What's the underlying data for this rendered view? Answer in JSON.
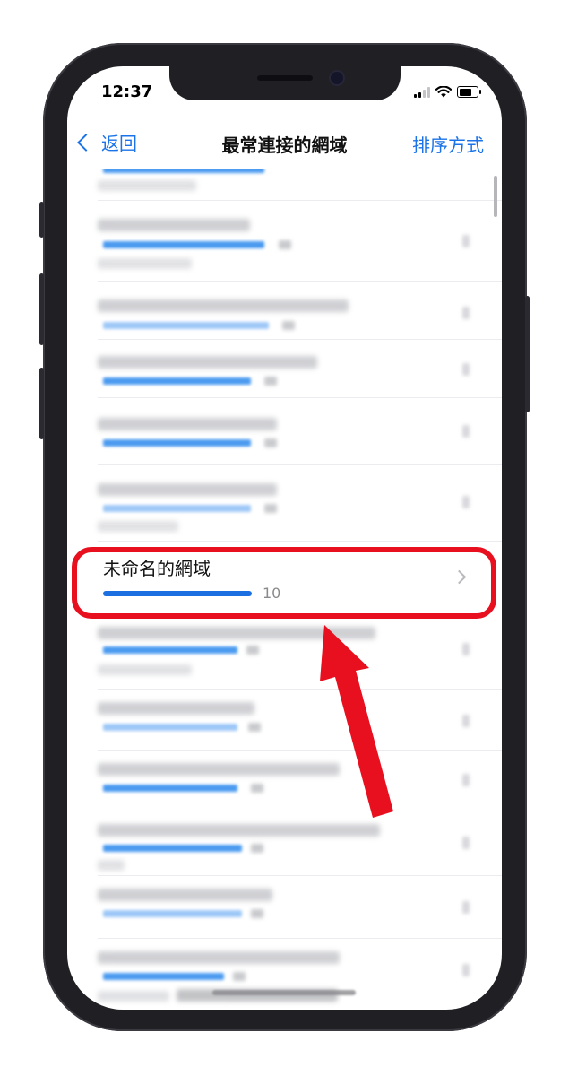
{
  "status_bar": {
    "time": "12:37"
  },
  "nav": {
    "back_label": "返回",
    "title": "最常連接的網域",
    "sort_label": "排序方式"
  },
  "highlighted_row": {
    "title": "未命名的網域",
    "count": "10"
  },
  "colors": {
    "accent": "#1a73e8",
    "highlight_border": "#e8101f",
    "arrow": "#e8101f"
  },
  "icons": [
    "back-chevron-icon",
    "signal-icon",
    "wifi-icon",
    "battery-icon",
    "disclosure-chevron-icon",
    "red-arrow-annotation"
  ]
}
